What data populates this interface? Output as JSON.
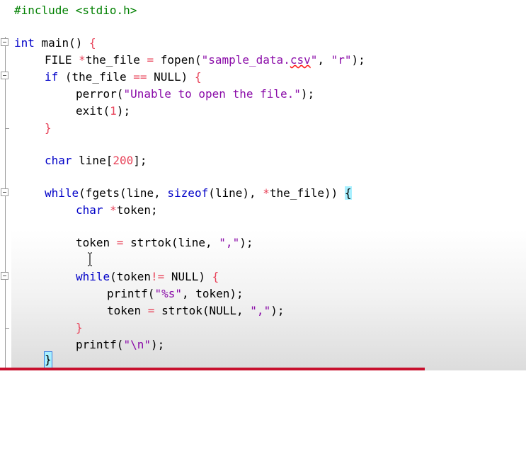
{
  "editor": {
    "lines": {
      "l1_pp": "#include <stdio.h>",
      "l2_kw": "int",
      "l2_rest": " main()",
      "l2_brace": " {",
      "l3_a": "FILE ",
      "l3_op": "*",
      "l3_b": "the_file ",
      "l3_eq": "=",
      "l3_c": " fopen(",
      "l3_s1a": "\"sample_data.",
      "l3_s1b": "csv",
      "l3_s1c": "\"",
      "l3_d": ", ",
      "l3_s2": "\"r\"",
      "l3_e": ");",
      "l4_kw": "if",
      "l4_a": " (the_file ",
      "l4_op": "==",
      "l4_b": " NULL) ",
      "l4_brace": "{",
      "l5_a": "perror(",
      "l5_s": "\"Unable to open the file.\"",
      "l5_b": ");",
      "l6_a": "exit(",
      "l6_n": "1",
      "l6_b": ");",
      "l7_brace": "}",
      "l8_kw": "char",
      "l8_a": " line[",
      "l8_n": "200",
      "l8_b": "];",
      "l9_kw": "while",
      "l9_a": "(fgets(line, ",
      "l9_kw2": "sizeof",
      "l9_b": "(line), ",
      "l9_op": "*",
      "l9_c": "the_file)) ",
      "l9_brace": "{",
      "l10_kw": "char",
      "l10_op": " *",
      "l10_a": "token;",
      "l11_a": "token ",
      "l11_op": "=",
      "l11_b": " strtok(line, ",
      "l11_s": "\",\"",
      "l11_c": ");",
      "l12_kw": "while",
      "l12_a": "(token",
      "l12_op": "!=",
      "l12_b": " NULL) ",
      "l12_brace": "{",
      "l13_a": "printf(",
      "l13_s": "\"%s\"",
      "l13_b": ", token);",
      "l14_a": "token ",
      "l14_op": "=",
      "l14_b": " strtok(NULL, ",
      "l14_s": "\",\"",
      "l14_c": ");",
      "l15_brace": "}",
      "l16_a": "printf(",
      "l16_s": "\"\\n\"",
      "l16_b": ");",
      "l17_brace": "}"
    }
  },
  "mouse_cursor_icon": "text-ibeam-icon",
  "colors": {
    "preprocessor": "#008000",
    "keyword": "#0000c8",
    "string": "#8a0ba8",
    "number": "#e8445a",
    "brace_highlight": "#a8f0ff"
  }
}
